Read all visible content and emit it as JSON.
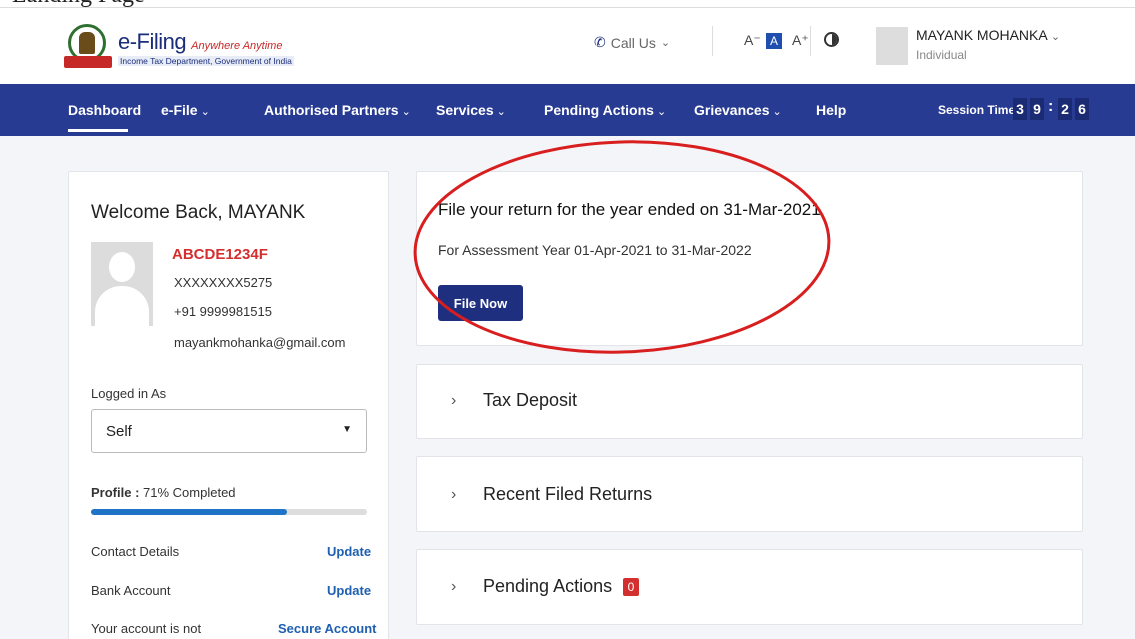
{
  "header": {
    "cut_text": "Landing Page",
    "brand": "e-Filing",
    "tagline": "Anywhere Anytime",
    "subtitle": "Income Tax Department, Government of India",
    "call_us": "Call Us",
    "font_decrease": "A⁻",
    "font_normal": "A",
    "font_increase": "A⁺",
    "user_name": "MAYANK MOHANKA",
    "user_role": "Individual"
  },
  "nav": {
    "items": [
      {
        "label": "Dashboard",
        "dropdown": false
      },
      {
        "label": "e-File",
        "dropdown": true
      },
      {
        "label": "Authorised Partners",
        "dropdown": true
      },
      {
        "label": "Services",
        "dropdown": true
      },
      {
        "label": "Pending Actions",
        "dropdown": true
      },
      {
        "label": "Grievances",
        "dropdown": true
      },
      {
        "label": "Help",
        "dropdown": false
      }
    ],
    "session_label": "Session Time",
    "session_digits": [
      "3",
      "9",
      "2",
      "6"
    ]
  },
  "profile": {
    "welcome": "Welcome Back, MAYANK",
    "pan": "ABCDE1234F",
    "aadhaar": "XXXXXXXX5275",
    "phone": "+91 9999981515",
    "email": "mayankmohanka@gmail.com",
    "logged_in_label": "Logged in As",
    "logged_in_value": "Self",
    "profile_label": "Profile :",
    "profile_status": "71% Completed",
    "profile_percent": 71,
    "contact_label": "Contact Details",
    "contact_action": "Update",
    "bank_label": "Bank Account",
    "bank_action": "Update",
    "secure_label": "Your account is not",
    "secure_action": "Secure Account"
  },
  "file_card": {
    "title": "File your return for the year ended on 31-Mar-2021",
    "subtitle": "For Assessment Year 01-Apr-2021 to 31-Mar-2022",
    "button": "File Now"
  },
  "accordion": [
    {
      "title": "Tax Deposit"
    },
    {
      "title": "Recent Filed Returns"
    },
    {
      "title": "Pending Actions",
      "badge": "0"
    }
  ],
  "colors": {
    "nav_bg": "#283b93",
    "highlight_oval": "#d81e1e",
    "pan_red": "#d32f2f"
  }
}
